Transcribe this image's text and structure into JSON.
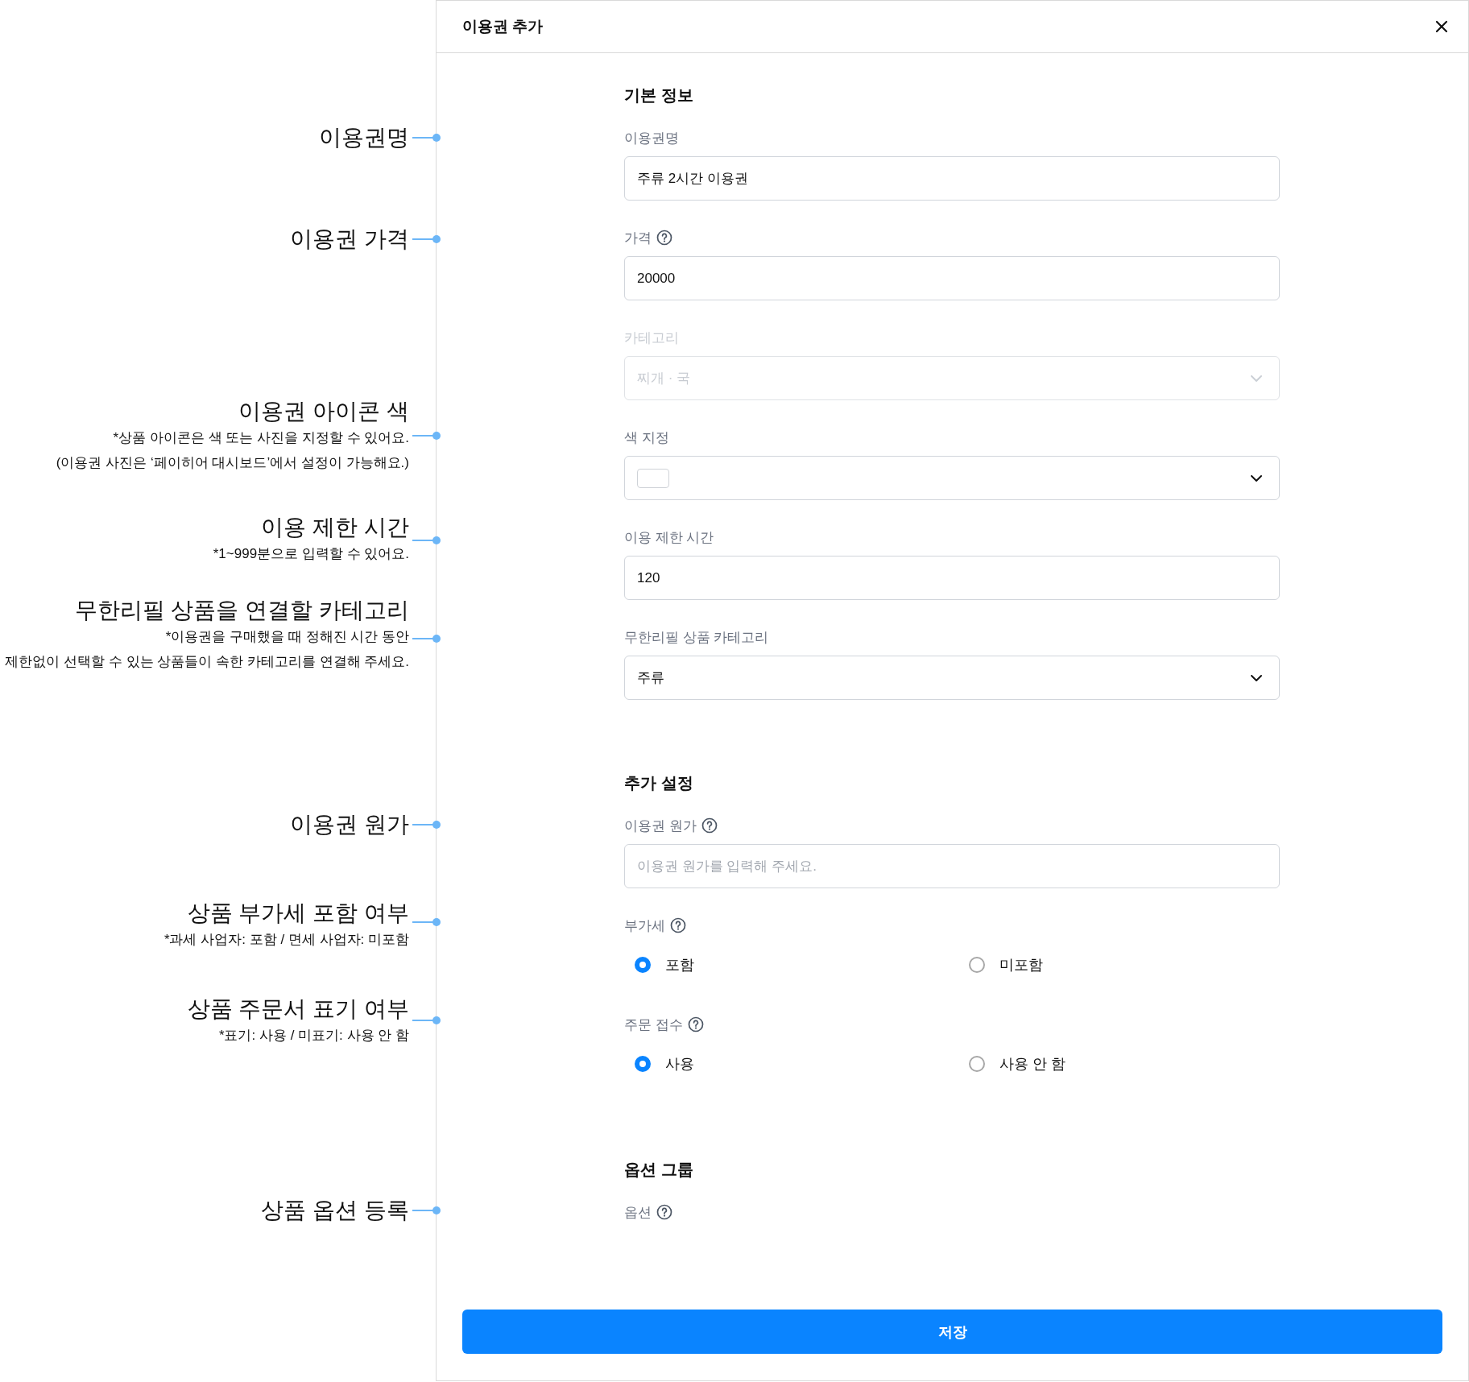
{
  "annotations": [
    {
      "title": "이용권명"
    },
    {
      "title": "이용권 가격"
    },
    {
      "title": "이용권 아이콘 색",
      "notes": [
        "*상품 아이콘은 색 또는 사진을 지정할 수 있어요.",
        "(이용권 사진은 ‘페이히어 대시보드’에서 설정이 가능해요.)"
      ]
    },
    {
      "title": "이용 제한 시간",
      "notes": [
        "*1~999분으로 입력할 수 있어요."
      ]
    },
    {
      "title": "무한리필 상품을 연결할 카테고리",
      "notes": [
        "*이용권을 구매했을 때 정해진 시간 동안",
        "제한없이 선택할 수 있는 상품들이 속한 카테고리를 연결해 주세요."
      ]
    },
    {
      "title": "이용권 원가"
    },
    {
      "title": "상품 부가세 포함 여부",
      "notes": [
        "*과세 사업자: 포함 / 면세 사업자: 미포함"
      ]
    },
    {
      "title": "상품 주문서 표기 여부",
      "notes": [
        "*표기: 사용 / 미표기: 사용 안 함"
      ]
    },
    {
      "title": "상품 옵션 등록"
    }
  ],
  "dialog": {
    "title": "이용권 추가"
  },
  "sections": [
    {
      "title": "기본 정보",
      "fields": [
        {
          "kind": "text",
          "label": "이용권명",
          "help": false,
          "disabled": false,
          "value": "주류 2시간 이용권"
        },
        {
          "kind": "text",
          "label": "가격",
          "help": true,
          "disabled": false,
          "value": "20000"
        },
        {
          "kind": "select",
          "label": "카테고리",
          "help": false,
          "disabled": true,
          "value": "찌개 · 국"
        },
        {
          "kind": "color",
          "label": "색 지정",
          "help": false,
          "color": "#ffffff"
        },
        {
          "kind": "text",
          "label": "이용 제한 시간",
          "help": false,
          "disabled": false,
          "value": "120"
        },
        {
          "kind": "select",
          "label": "무한리필 상품 카테고리",
          "help": false,
          "disabled": false,
          "value": "주류"
        }
      ]
    },
    {
      "title": "추가 설정",
      "fields": [
        {
          "kind": "text",
          "label": "이용권 원가",
          "help": true,
          "disabled": false,
          "placeholder": "이용권 원가를 입력해 주세요."
        },
        {
          "kind": "radio",
          "label": "부가세",
          "help": true,
          "options": [
            {
              "label": "포함",
              "selected": true
            },
            {
              "label": "미포함",
              "selected": false
            }
          ]
        },
        {
          "kind": "radio",
          "label": "주문 접수",
          "help": true,
          "options": [
            {
              "label": "사용",
              "selected": true
            },
            {
              "label": "사용 안 함",
              "selected": false
            }
          ]
        }
      ]
    },
    {
      "title": "옵션 그룹",
      "fields": [
        {
          "kind": "label",
          "label": "옵션",
          "help": true
        }
      ]
    }
  ],
  "save_button": "저장"
}
